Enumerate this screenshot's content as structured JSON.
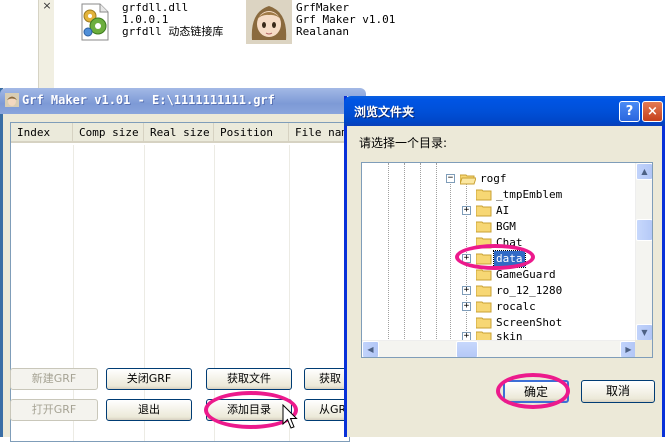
{
  "explorer": {
    "files": [
      {
        "name": "grfdll.dll",
        "version": "1.0.0.1",
        "description": "grfdll 动态链接库",
        "icon": "dll-file-icon"
      },
      {
        "name": "GrfMaker",
        "version": "Grf Maker v1.01",
        "description": "Realanan",
        "icon": "anime-character-app-icon"
      }
    ],
    "left_pane_close": "×"
  },
  "grf_window": {
    "title": "Grf Maker v1.01 - E:\\1111111111.grf",
    "columns": [
      "Index",
      "Comp size",
      "Real size",
      "Position",
      "File nam"
    ],
    "rows": [],
    "buttons_row1": [
      {
        "label": "新建GRF",
        "enabled": false
      },
      {
        "label": "关闭GRF",
        "enabled": true
      },
      {
        "label": "获取文件",
        "enabled": true
      },
      {
        "label": "获取",
        "enabled": true
      }
    ],
    "buttons_row2": [
      {
        "label": "打开GRF",
        "enabled": false
      },
      {
        "label": "退出",
        "enabled": true
      },
      {
        "label": "添加目录",
        "enabled": true,
        "highlighted": true
      },
      {
        "label": "从GR",
        "enabled": true
      }
    ]
  },
  "browse_dialog": {
    "title": "浏览文件夹",
    "help_symbol": "?",
    "close_symbol": "×",
    "prompt": "请选择一个目录:",
    "tree": [
      {
        "label": "rogf",
        "expanded": true,
        "expander": "−"
      },
      {
        "label": "_tmpEmblem",
        "expander": ""
      },
      {
        "label": "AI",
        "expander": "+"
      },
      {
        "label": "BGM",
        "expander": ""
      },
      {
        "label": "Chat",
        "expander": ""
      },
      {
        "label": "data",
        "expander": "+",
        "selected": true,
        "highlighted": true
      },
      {
        "label": "GameGuard",
        "expander": ""
      },
      {
        "label": "ro_12_1280",
        "expander": "+"
      },
      {
        "label": "rocalc",
        "expander": "+"
      },
      {
        "label": "ScreenShot",
        "expander": ""
      },
      {
        "label": "skin",
        "expander": "+"
      }
    ],
    "ok_label": "确定",
    "cancel_label": "取消",
    "scroll_up": "▲",
    "scroll_down": "▼",
    "scroll_left": "◀",
    "scroll_right": "▶"
  },
  "colors": {
    "annotation": "#ec1a8c",
    "selection": "#316ac5",
    "xp_title_blue": "#0054e3",
    "inactive_title": "#7d9ad6"
  }
}
